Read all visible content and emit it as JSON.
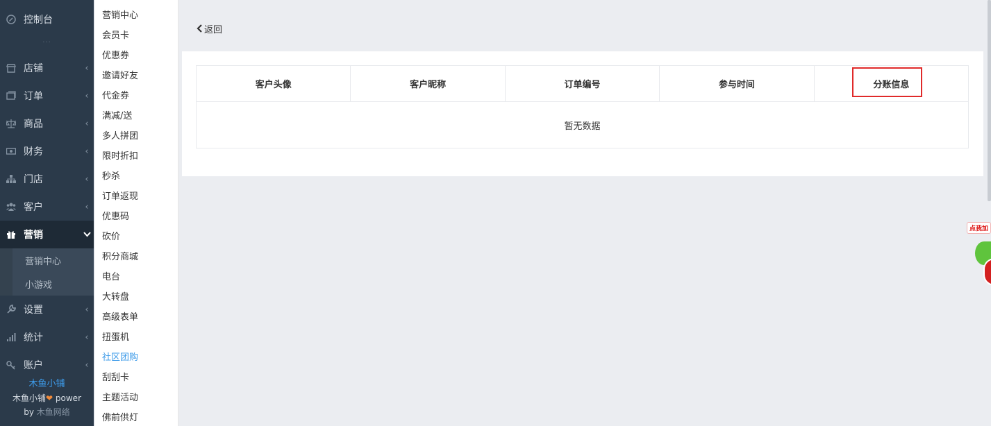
{
  "sidebar": {
    "items": [
      {
        "label": "控制台",
        "icon": "dashboard-icon"
      },
      {
        "label": "店铺",
        "icon": "shop-icon"
      },
      {
        "label": "订单",
        "icon": "order-icon"
      },
      {
        "label": "商品",
        "icon": "scale-icon"
      },
      {
        "label": "财务",
        "icon": "money-icon"
      },
      {
        "label": "门店",
        "icon": "sitemap-icon"
      },
      {
        "label": "客户",
        "icon": "users-icon"
      },
      {
        "label": "营销",
        "icon": "gift-icon"
      },
      {
        "label": "设置",
        "icon": "wrench-icon"
      },
      {
        "label": "统计",
        "icon": "signal-icon"
      },
      {
        "label": "账户",
        "icon": "key-icon"
      }
    ],
    "dots": "···",
    "subitems": [
      "营销中心",
      "小游戏"
    ]
  },
  "brand": {
    "name": "木鱼小铺",
    "line2_name": "木鱼小铺",
    "line2_power": "power",
    "line3_by": "by",
    "line3_company": "木鱼网络"
  },
  "subnav": {
    "items": [
      "营销中心",
      "会员卡",
      "优惠券",
      "邀请好友",
      "代金券",
      "满减/送",
      "多人拼团",
      "限时折扣",
      "秒杀",
      "订单返现",
      "优惠码",
      "砍价",
      "积分商城",
      "电台",
      "大转盘",
      "高级表单",
      "扭蛋机",
      "社区团购",
      "刮刮卡",
      "主题活动",
      "佛前供灯"
    ]
  },
  "main": {
    "back_label": "返回",
    "table": {
      "columns": [
        "客户头像",
        "客户昵称",
        "订单编号",
        "参与时间",
        "分账信息"
      ],
      "empty_text": "暂无数据"
    }
  },
  "widget": {
    "tag": "点我加"
  }
}
